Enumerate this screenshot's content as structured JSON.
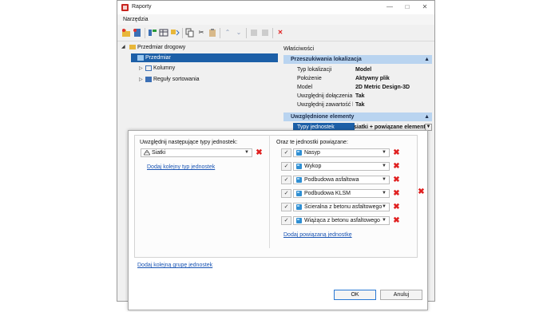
{
  "window": {
    "title": "Raporty",
    "menu": [
      "Narzędzia"
    ]
  },
  "tree": {
    "root": "Przedmiar drogowy",
    "selected": "Przedmiar",
    "children": [
      "Kolumny",
      "Reguły sortowania"
    ]
  },
  "properties": {
    "title": "Właściwości",
    "section1": {
      "title": "Przeszukiwania lokalizacja",
      "rows": [
        {
          "name": "Typ lokalizacji",
          "value": "Model"
        },
        {
          "name": "Położenie",
          "value": "Aktywny plik"
        },
        {
          "name": "Model",
          "value": "2D Metric Design-3D"
        },
        {
          "name": "Uwzględnij dołączenia oc",
          "value": "Tak"
        },
        {
          "name": "Uwzględnij zawartość kor",
          "value": "Tak"
        }
      ]
    },
    "section2": {
      "title": "Uwzględnione elementy",
      "row": {
        "name": "Typy jednostek",
        "value": "siatki + powiązane elementy"
      }
    }
  },
  "dialog": {
    "left_label": "Uwzględnij następujące typy jednostek:",
    "entity_type": "Siatki",
    "add_type_link": "Dodaj kolejny typ jednostek",
    "right_label": "Oraz te jednostki powiązane:",
    "related": [
      "Nasyp",
      "Wykop",
      "Podbudowa asfaltowa",
      "Podbudowa KLSM",
      "Ścieralna z betonu asfaltowego",
      "Wiążąca z betonu asfaltowego"
    ],
    "add_related_link": "Dodaj powiązaną jednostkę",
    "add_group_link": "Dodaj kolejną grupę jednostek",
    "ok": "OK",
    "cancel": "Anuluj"
  },
  "colors": {
    "accent": "#1c5fa7",
    "section": "#b9d4f0",
    "delete": "#e02020",
    "link": "#1a55b4"
  },
  "icons": [
    "app-icon",
    "folder-icon",
    "report-icon",
    "columns-icon",
    "sort-rules-icon",
    "mesh-icon",
    "cube-icon",
    "check-icon",
    "delete-icon"
  ]
}
